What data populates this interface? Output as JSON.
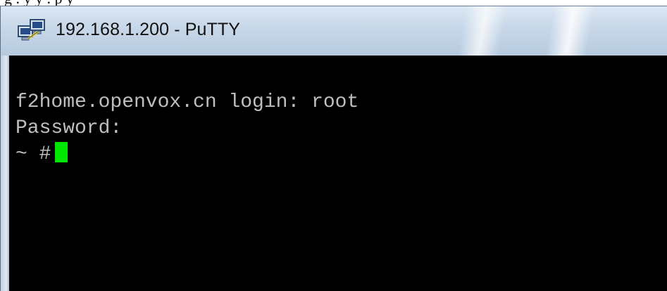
{
  "window": {
    "title": "192.168.1.200 - PuTTY",
    "icon": "putty-icon"
  },
  "terminal": {
    "lines": [
      "f2home.openvox.cn login: root",
      "Password:"
    ],
    "prompt": "~ #",
    "cursor_color": "#00e600",
    "text_color": "#bfbfbf",
    "background_color": "#000000"
  },
  "caption_fragment": "g . y y  . p y"
}
